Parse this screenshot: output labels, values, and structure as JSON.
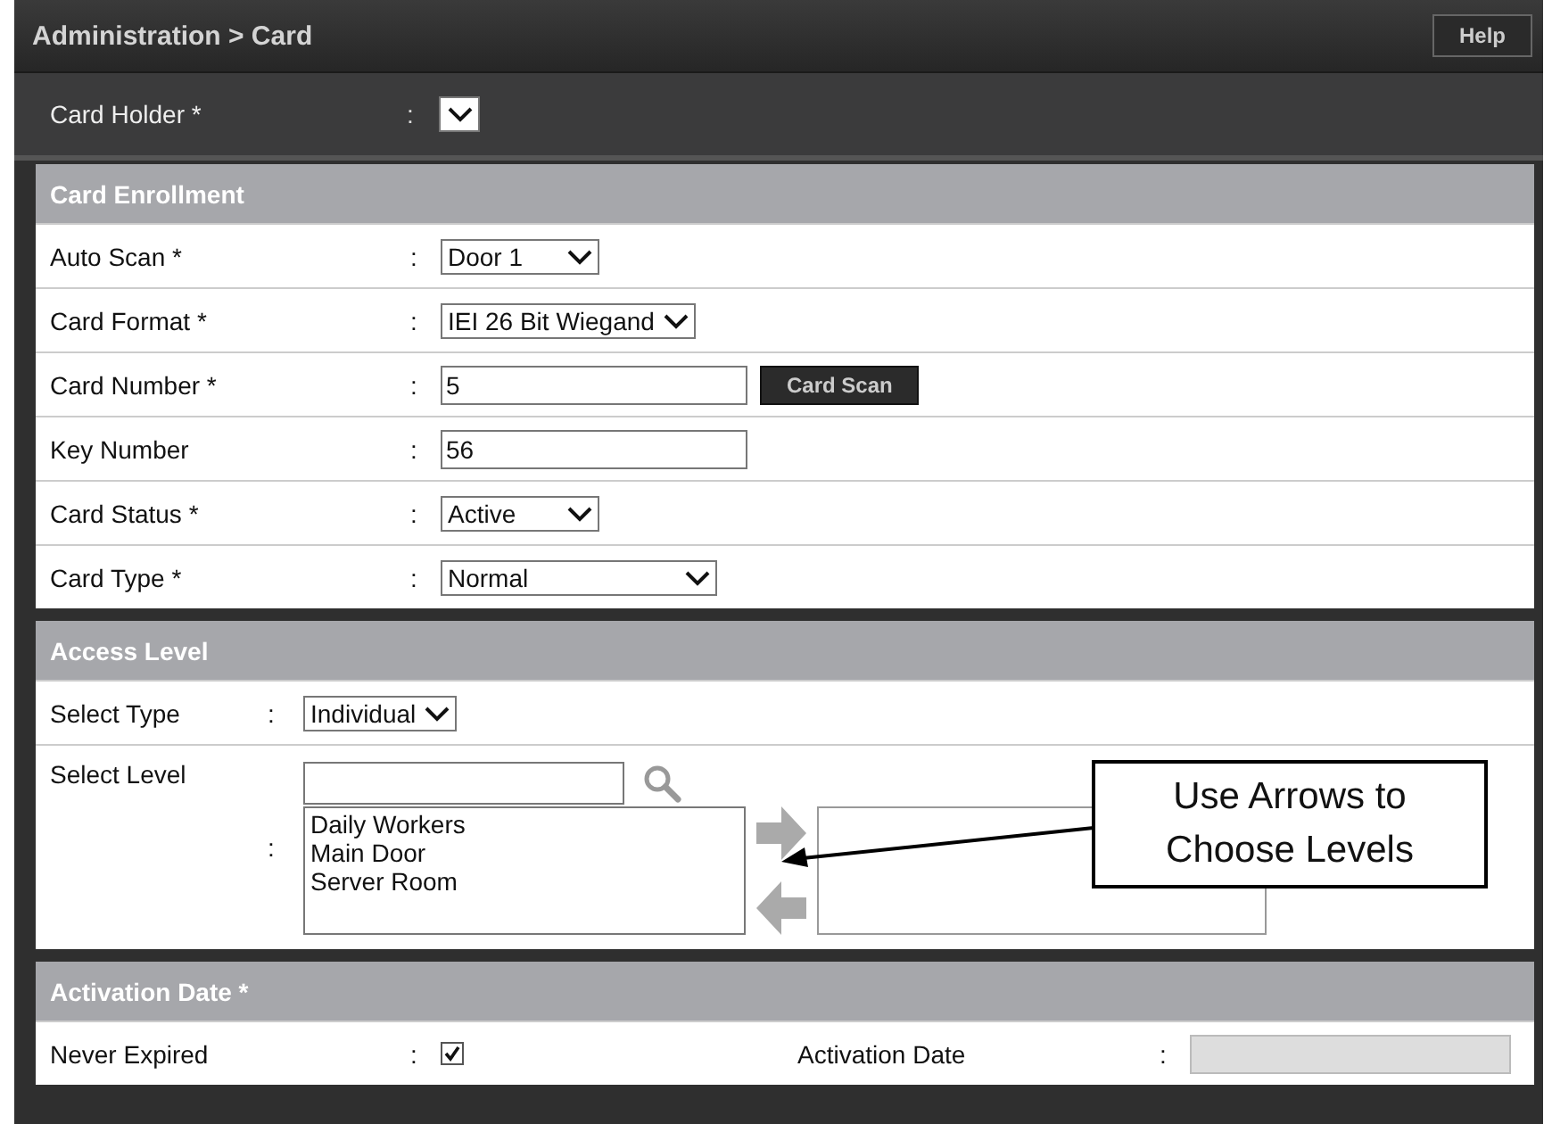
{
  "header": {
    "breadcrumb": "Administration > Card",
    "help_button": "Help"
  },
  "card_holder": {
    "label": "Card Holder *",
    "colon": ":"
  },
  "enrollment": {
    "title": "Card Enrollment",
    "fields": [
      {
        "label": "Auto Scan *",
        "colon": ":",
        "kind": "select",
        "value": "Door 1"
      },
      {
        "label": "Card Format *",
        "colon": ":",
        "kind": "select",
        "value": "IEI 26 Bit Wiegand"
      },
      {
        "label": "Card Number *",
        "colon": ":",
        "kind": "input",
        "value": "5",
        "button": "Card Scan"
      },
      {
        "label": "Key Number",
        "colon": ":",
        "kind": "input",
        "value": "56"
      },
      {
        "label": "Card Status *",
        "colon": ":",
        "kind": "select",
        "value": "Active"
      },
      {
        "label": "Card Type *",
        "colon": ":",
        "kind": "select",
        "value": "Normal"
      }
    ]
  },
  "access_level": {
    "title": "Access Level",
    "select_type": {
      "label": "Select Type",
      "colon": ":",
      "value": "Individual"
    },
    "select_level": {
      "label": "Select Level",
      "colon": ":",
      "available": [
        "Daily Workers",
        "Main Door",
        "Server Room"
      ]
    }
  },
  "callout": {
    "text": "Use Arrows to Choose Levels"
  },
  "activation": {
    "title": "Activation Date *",
    "fields": [
      {
        "label": "Never Expired",
        "colon": ":",
        "kind": "checkbox",
        "checked": true
      },
      {
        "label": "Activation Date",
        "colon": ":",
        "kind": "date"
      }
    ]
  }
}
